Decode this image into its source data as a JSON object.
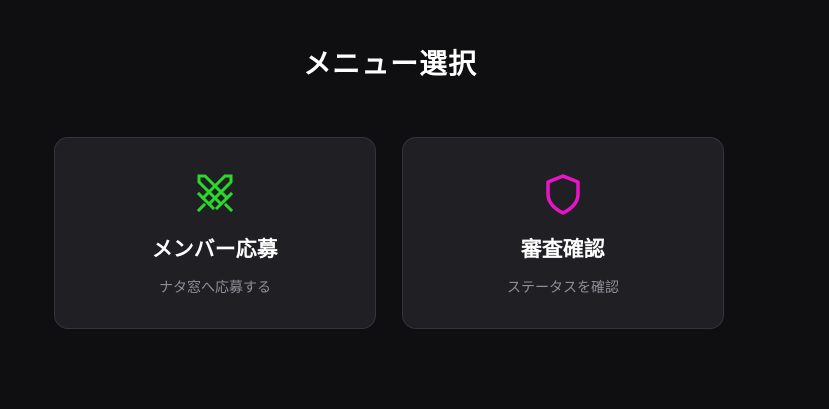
{
  "page": {
    "title": "メニュー選択"
  },
  "cards": [
    {
      "title": "メンバー応募",
      "description": "ナタ窓へ応募する",
      "icon": "crossed-swords-icon",
      "icon_color": "#2bd92b"
    },
    {
      "title": "審査確認",
      "description": "ステータスを確認",
      "icon": "shield-icon",
      "icon_color": "#e815c8"
    }
  ],
  "colors": {
    "background": "#0f0f11",
    "card_background": "#1f1f24",
    "card_border": "#34343c",
    "description_text": "#8e8e98"
  }
}
